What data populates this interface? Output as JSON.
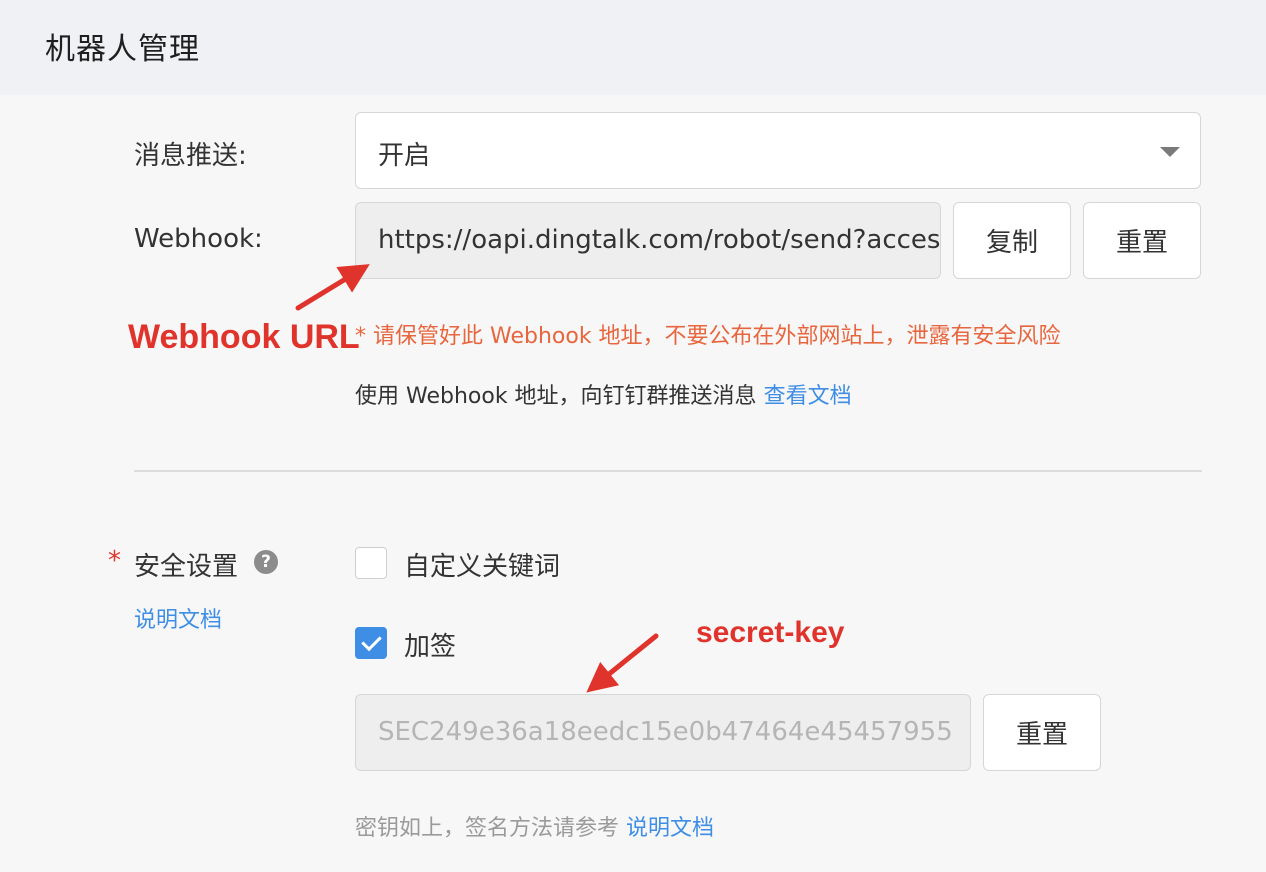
{
  "header": {
    "title": "机器人管理"
  },
  "push": {
    "label": "消息推送:",
    "select_value": "开启"
  },
  "webhook": {
    "label": "Webhook:",
    "url": "https://oapi.dingtalk.com/robot/send?access_token=",
    "copy_label": "复制",
    "reset_label": "重置",
    "warning": "* 请保管好此 Webhook 地址，不要公布在外部网站上，泄露有安全风险",
    "hint_text": "使用 Webhook 地址，向钉钉群推送消息 ",
    "hint_link": "查看文档"
  },
  "security": {
    "required_mark": "*",
    "label": "安全设置",
    "help_icon": "?",
    "doc_link": "说明文档",
    "options": [
      {
        "label": "自定义关键词",
        "checked": false
      },
      {
        "label": "加签",
        "checked": true
      }
    ],
    "secret_value": "SEC249e36a18eedc15e0b47464e45457955",
    "secret_reset_label": "重置",
    "secret_hint_text": "密钥如上，签名方法请参考 ",
    "secret_hint_link": "说明文档"
  },
  "annotations": {
    "webhook_url": "Webhook URL",
    "secret_key": "secret-key",
    "color": "#e0332c"
  },
  "colors": {
    "accent": "#3e8ee6",
    "warning": "#e8663e",
    "required": "#e0362d"
  }
}
